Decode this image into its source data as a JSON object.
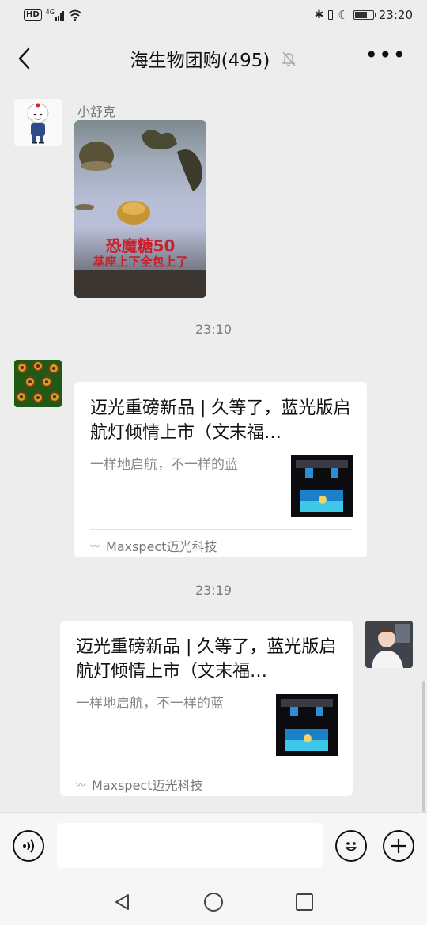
{
  "status_bar": {
    "hd": "HD",
    "network": "4G",
    "time": "23:20",
    "battery_level": 0.65
  },
  "header": {
    "title": "海生物团购(495)"
  },
  "messages": {
    "sender_name": "小舒克",
    "image_caption_1": "恐魔糖50",
    "image_caption_2": "基座上下全包上了",
    "time_1": "23:10",
    "time_2": "23:19",
    "card_received": {
      "title": "迈光重磅新品 | 久等了，蓝光版启航灯倾情上市（文末福…",
      "desc": "一样地启航，不一样的蓝",
      "source": "Maxspect迈光科技"
    },
    "card_sent": {
      "title": "迈光重磅新品 | 久等了，蓝光版启航灯倾情上市（文末福…",
      "desc": "一样地启航，不一样的蓝",
      "source": "Maxspect迈光科技"
    }
  },
  "input_bar": {
    "placeholder": ""
  },
  "icons": {
    "back": "back-icon",
    "mute": "mute-icon",
    "more": "more-icon",
    "voice": "voice-icon",
    "emoji": "emoji-icon",
    "plus": "plus-icon",
    "nav_back": "nav-back-icon",
    "nav_home": "nav-home-icon",
    "nav_recent": "nav-recent-icon"
  }
}
